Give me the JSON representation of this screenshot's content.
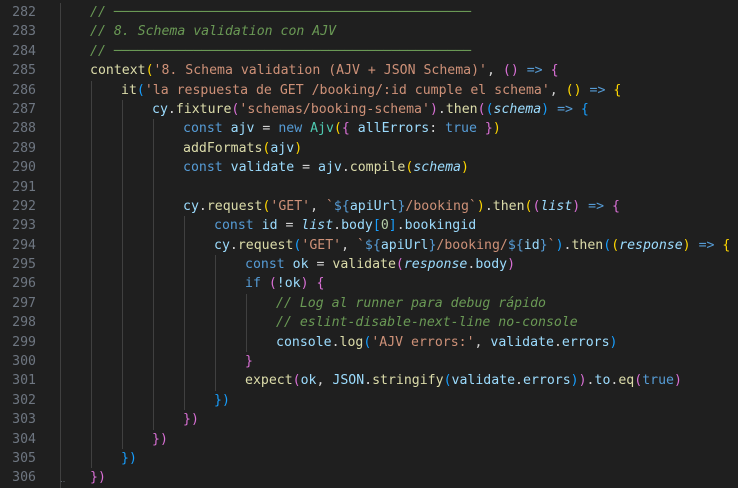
{
  "editor": {
    "first_line_number": 282,
    "lines": [
      {
        "n": "282",
        "indent": 1,
        "tokens": [
          {
            "t": "// ─────────────────────────────────────────────",
            "c": "cmt"
          }
        ]
      },
      {
        "n": "283",
        "indent": 1,
        "tokens": [
          {
            "t": "// 8. Schema validation con AJV",
            "c": "cmt"
          }
        ]
      },
      {
        "n": "284",
        "indent": 1,
        "tokens": [
          {
            "t": "// ─────────────────────────────────────────────",
            "c": "cmt"
          }
        ]
      },
      {
        "n": "285",
        "indent": 1,
        "tokens": [
          {
            "t": "context",
            "c": "fn"
          },
          {
            "t": "(",
            "c": "p1"
          },
          {
            "t": "'8. Schema validation (AJV + JSON Schema)'",
            "c": "str"
          },
          {
            "t": ", ",
            "c": "plain"
          },
          {
            "t": "()",
            "c": "p2"
          },
          {
            "t": " ",
            "c": "plain"
          },
          {
            "t": "=>",
            "c": "kw"
          },
          {
            "t": " ",
            "c": "plain"
          },
          {
            "t": "{",
            "c": "p2"
          }
        ]
      },
      {
        "n": "286",
        "indent": 2,
        "tokens": [
          {
            "t": "it",
            "c": "fn"
          },
          {
            "t": "(",
            "c": "p3"
          },
          {
            "t": "'la respuesta de GET /booking/:id cumple el schema'",
            "c": "str"
          },
          {
            "t": ", ",
            "c": "plain"
          },
          {
            "t": "()",
            "c": "p1"
          },
          {
            "t": " ",
            "c": "plain"
          },
          {
            "t": "=>",
            "c": "kw"
          },
          {
            "t": " ",
            "c": "plain"
          },
          {
            "t": "{",
            "c": "p1"
          }
        ]
      },
      {
        "n": "287",
        "indent": 3,
        "tokens": [
          {
            "t": "cy",
            "c": "var"
          },
          {
            "t": ".",
            "c": "plain"
          },
          {
            "t": "fixture",
            "c": "fn"
          },
          {
            "t": "(",
            "c": "p2"
          },
          {
            "t": "'schemas/booking-schema'",
            "c": "str"
          },
          {
            "t": ")",
            "c": "p2"
          },
          {
            "t": ".",
            "c": "plain"
          },
          {
            "t": "then",
            "c": "fn"
          },
          {
            "t": "(",
            "c": "p2"
          },
          {
            "t": "(",
            "c": "p3"
          },
          {
            "t": "schema",
            "c": "ital"
          },
          {
            "t": ")",
            "c": "p3"
          },
          {
            "t": " ",
            "c": "plain"
          },
          {
            "t": "=>",
            "c": "kw"
          },
          {
            "t": " ",
            "c": "plain"
          },
          {
            "t": "{",
            "c": "p3"
          }
        ]
      },
      {
        "n": "288",
        "indent": 4,
        "tokens": [
          {
            "t": "const",
            "c": "kw"
          },
          {
            "t": " ",
            "c": "plain"
          },
          {
            "t": "ajv",
            "c": "var"
          },
          {
            "t": " = ",
            "c": "plain"
          },
          {
            "t": "new",
            "c": "kw"
          },
          {
            "t": " ",
            "c": "plain"
          },
          {
            "t": "Ajv",
            "c": "cls"
          },
          {
            "t": "(",
            "c": "p1"
          },
          {
            "t": "{",
            "c": "p2"
          },
          {
            "t": " ",
            "c": "plain"
          },
          {
            "t": "allErrors",
            "c": "prop"
          },
          {
            "t": ": ",
            "c": "plain"
          },
          {
            "t": "true",
            "c": "kw"
          },
          {
            "t": " ",
            "c": "plain"
          },
          {
            "t": "}",
            "c": "p2"
          },
          {
            "t": ")",
            "c": "p1"
          }
        ]
      },
      {
        "n": "289",
        "indent": 4,
        "tokens": [
          {
            "t": "addFormats",
            "c": "fn"
          },
          {
            "t": "(",
            "c": "p1"
          },
          {
            "t": "ajv",
            "c": "var"
          },
          {
            "t": ")",
            "c": "p1"
          }
        ]
      },
      {
        "n": "290",
        "indent": 4,
        "tokens": [
          {
            "t": "const",
            "c": "kw"
          },
          {
            "t": " ",
            "c": "plain"
          },
          {
            "t": "validate",
            "c": "var"
          },
          {
            "t": " = ",
            "c": "plain"
          },
          {
            "t": "ajv",
            "c": "var"
          },
          {
            "t": ".",
            "c": "plain"
          },
          {
            "t": "compile",
            "c": "fn"
          },
          {
            "t": "(",
            "c": "p1"
          },
          {
            "t": "schema",
            "c": "ital"
          },
          {
            "t": ")",
            "c": "p1"
          }
        ]
      },
      {
        "n": "291",
        "indent": 4,
        "tokens": []
      },
      {
        "n": "292",
        "indent": 4,
        "tokens": [
          {
            "t": "cy",
            "c": "var"
          },
          {
            "t": ".",
            "c": "plain"
          },
          {
            "t": "request",
            "c": "fn"
          },
          {
            "t": "(",
            "c": "p1"
          },
          {
            "t": "'GET'",
            "c": "str"
          },
          {
            "t": ", ",
            "c": "plain"
          },
          {
            "t": "`",
            "c": "str"
          },
          {
            "t": "${",
            "c": "kw"
          },
          {
            "t": "apiUrl",
            "c": "var"
          },
          {
            "t": "}",
            "c": "kw"
          },
          {
            "t": "/booking`",
            "c": "str"
          },
          {
            "t": ")",
            "c": "p1"
          },
          {
            "t": ".",
            "c": "plain"
          },
          {
            "t": "then",
            "c": "fn"
          },
          {
            "t": "(",
            "c": "p1"
          },
          {
            "t": "(",
            "c": "p2"
          },
          {
            "t": "list",
            "c": "ital"
          },
          {
            "t": ")",
            "c": "p2"
          },
          {
            "t": " ",
            "c": "plain"
          },
          {
            "t": "=>",
            "c": "kw"
          },
          {
            "t": " ",
            "c": "plain"
          },
          {
            "t": "{",
            "c": "p2"
          }
        ]
      },
      {
        "n": "293",
        "indent": 5,
        "tokens": [
          {
            "t": "const",
            "c": "kw"
          },
          {
            "t": " ",
            "c": "plain"
          },
          {
            "t": "id",
            "c": "var"
          },
          {
            "t": " = ",
            "c": "plain"
          },
          {
            "t": "list",
            "c": "ital"
          },
          {
            "t": ".",
            "c": "plain"
          },
          {
            "t": "body",
            "c": "prop"
          },
          {
            "t": "[",
            "c": "p3"
          },
          {
            "t": "0",
            "c": "num"
          },
          {
            "t": "]",
            "c": "p3"
          },
          {
            "t": ".",
            "c": "plain"
          },
          {
            "t": "bookingid",
            "c": "prop"
          }
        ]
      },
      {
        "n": "294",
        "indent": 5,
        "tokens": [
          {
            "t": "cy",
            "c": "var"
          },
          {
            "t": ".",
            "c": "plain"
          },
          {
            "t": "request",
            "c": "fn"
          },
          {
            "t": "(",
            "c": "p3"
          },
          {
            "t": "'GET'",
            "c": "str"
          },
          {
            "t": ", ",
            "c": "plain"
          },
          {
            "t": "`",
            "c": "str"
          },
          {
            "t": "${",
            "c": "kw"
          },
          {
            "t": "apiUrl",
            "c": "var"
          },
          {
            "t": "}",
            "c": "kw"
          },
          {
            "t": "/booking/",
            "c": "str"
          },
          {
            "t": "${",
            "c": "kw"
          },
          {
            "t": "id",
            "c": "var"
          },
          {
            "t": "}",
            "c": "kw"
          },
          {
            "t": "`",
            "c": "str"
          },
          {
            "t": ")",
            "c": "p3"
          },
          {
            "t": ".",
            "c": "plain"
          },
          {
            "t": "then",
            "c": "fn"
          },
          {
            "t": "(",
            "c": "p3"
          },
          {
            "t": "(",
            "c": "p1"
          },
          {
            "t": "response",
            "c": "ital"
          },
          {
            "t": ")",
            "c": "p1"
          },
          {
            "t": " ",
            "c": "plain"
          },
          {
            "t": "=>",
            "c": "kw"
          },
          {
            "t": " ",
            "c": "plain"
          },
          {
            "t": "{",
            "c": "p1"
          }
        ]
      },
      {
        "n": "295",
        "indent": 6,
        "tokens": [
          {
            "t": "const",
            "c": "kw"
          },
          {
            "t": " ",
            "c": "plain"
          },
          {
            "t": "ok",
            "c": "var"
          },
          {
            "t": " = ",
            "c": "plain"
          },
          {
            "t": "validate",
            "c": "fn"
          },
          {
            "t": "(",
            "c": "p2"
          },
          {
            "t": "response",
            "c": "ital"
          },
          {
            "t": ".",
            "c": "plain"
          },
          {
            "t": "body",
            "c": "prop"
          },
          {
            "t": ")",
            "c": "p2"
          }
        ]
      },
      {
        "n": "296",
        "indent": 6,
        "tokens": [
          {
            "t": "if",
            "c": "kw"
          },
          {
            "t": " ",
            "c": "plain"
          },
          {
            "t": "(",
            "c": "p2"
          },
          {
            "t": "!ok",
            "c": "var"
          },
          {
            "t": ")",
            "c": "p2"
          },
          {
            "t": " ",
            "c": "plain"
          },
          {
            "t": "{",
            "c": "p2"
          }
        ]
      },
      {
        "n": "297",
        "indent": 7,
        "tokens": [
          {
            "t": "// Log al runner para debug rápido",
            "c": "cmt"
          }
        ]
      },
      {
        "n": "298",
        "indent": 7,
        "tokens": [
          {
            "t": "// eslint-disable-next-line no-console",
            "c": "cmt"
          }
        ]
      },
      {
        "n": "299",
        "indent": 7,
        "tokens": [
          {
            "t": "console",
            "c": "var"
          },
          {
            "t": ".",
            "c": "plain"
          },
          {
            "t": "log",
            "c": "fn"
          },
          {
            "t": "(",
            "c": "p3"
          },
          {
            "t": "'AJV errors:'",
            "c": "str"
          },
          {
            "t": ", ",
            "c": "plain"
          },
          {
            "t": "validate",
            "c": "var"
          },
          {
            "t": ".",
            "c": "plain"
          },
          {
            "t": "errors",
            "c": "prop"
          },
          {
            "t": ")",
            "c": "p3"
          }
        ]
      },
      {
        "n": "300",
        "indent": 6,
        "tokens": [
          {
            "t": "}",
            "c": "p2"
          }
        ]
      },
      {
        "n": "301",
        "indent": 6,
        "tokens": [
          {
            "t": "expect",
            "c": "fn"
          },
          {
            "t": "(",
            "c": "p2"
          },
          {
            "t": "ok",
            "c": "var"
          },
          {
            "t": ", ",
            "c": "plain"
          },
          {
            "t": "JSON",
            "c": "var"
          },
          {
            "t": ".",
            "c": "plain"
          },
          {
            "t": "stringify",
            "c": "fn"
          },
          {
            "t": "(",
            "c": "p3"
          },
          {
            "t": "validate",
            "c": "var"
          },
          {
            "t": ".",
            "c": "plain"
          },
          {
            "t": "errors",
            "c": "prop"
          },
          {
            "t": ")",
            "c": "p3"
          },
          {
            "t": ")",
            "c": "p2"
          },
          {
            "t": ".",
            "c": "plain"
          },
          {
            "t": "to",
            "c": "prop"
          },
          {
            "t": ".",
            "c": "plain"
          },
          {
            "t": "eq",
            "c": "fn"
          },
          {
            "t": "(",
            "c": "p2"
          },
          {
            "t": "true",
            "c": "kw"
          },
          {
            "t": ")",
            "c": "p2"
          }
        ]
      },
      {
        "n": "302",
        "indent": 5,
        "tokens": [
          {
            "t": "})",
            "c": "p3"
          }
        ]
      },
      {
        "n": "303",
        "indent": 4,
        "tokens": [
          {
            "t": "})",
            "c": "p2"
          }
        ]
      },
      {
        "n": "304",
        "indent": 3,
        "tokens": [
          {
            "t": "})",
            "c": "p2"
          }
        ]
      },
      {
        "n": "305",
        "indent": 2,
        "tokens": [
          {
            "t": "})",
            "c": "p3"
          }
        ]
      },
      {
        "n": "306",
        "indent": 1,
        "tokens": [
          {
            "t": "})",
            "c": "p2"
          }
        ]
      }
    ]
  }
}
